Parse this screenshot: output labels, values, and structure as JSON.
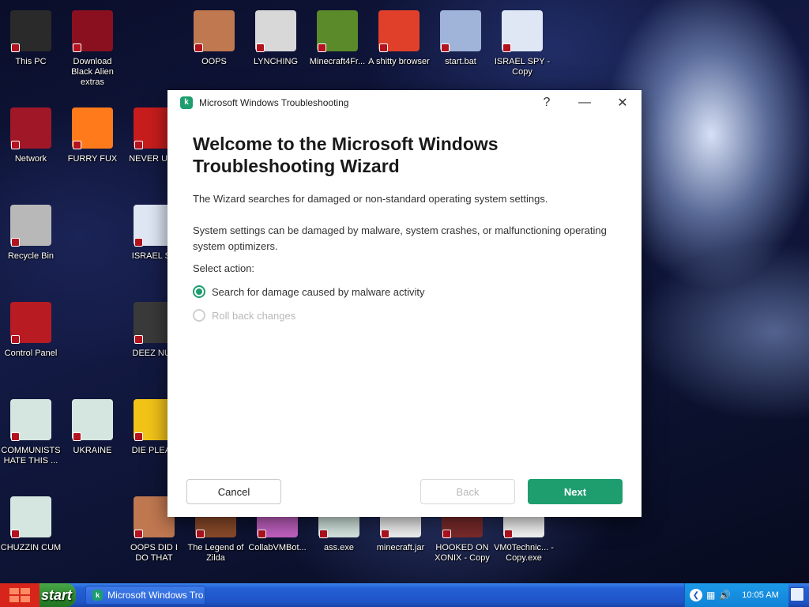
{
  "desktop": {
    "icons": [
      {
        "label": "This PC",
        "icon": "computer-icon",
        "color": "#2a2a2a"
      },
      {
        "label": "Download Black Alien extras",
        "icon": "alien-icon",
        "color": "#8a1020"
      },
      {
        "label": "OOPS",
        "icon": "portrait-icon",
        "color": "#c07850"
      },
      {
        "label": "LYNCHING",
        "icon": "rope-icon",
        "color": "#d8d8d8"
      },
      {
        "label": "Minecraft4Fr...",
        "icon": "grass-block-icon",
        "color": "#5a8a2a"
      },
      {
        "label": "A shitty browser",
        "icon": "chrome-icon",
        "color": "#e0402a"
      },
      {
        "label": "start.bat",
        "icon": "gears-icon",
        "color": "#9fb4d8"
      },
      {
        "label": "ISRAEL SPY - Copy",
        "icon": "network-pipe-icon",
        "color": "#dfe7f5"
      },
      {
        "label": "Network",
        "icon": "alien-network-icon",
        "color": "#a01828"
      },
      {
        "label": "FURRY FUX",
        "icon": "firefox-icon",
        "color": "#ff7a1a"
      },
      {
        "label": "NEVER USE",
        "icon": "devcpp-icon",
        "color": "#c81d1d"
      },
      {
        "label": "Recycle Bin",
        "icon": "recycle-bin-icon",
        "color": "#b8b8b8"
      },
      {
        "label": "ISRAEL SP",
        "icon": "network-pipe-icon",
        "color": "#dfe7f5"
      },
      {
        "label": "Control Panel",
        "icon": "control-panel-icon",
        "color": "#b81b22"
      },
      {
        "label": "DEEZ NUT",
        "icon": "copy-windows-icon",
        "color": "#3a3a3a"
      },
      {
        "label": "COMMUNISTS HATE THIS ...",
        "icon": "window-thumbnail-icon",
        "color": "#d5e6e0"
      },
      {
        "label": "UKRAINE",
        "icon": "window-thumbnail-icon",
        "color": "#d5e6e0"
      },
      {
        "label": "DIE PLEAS",
        "icon": "die-logo-icon",
        "color": "#f2c418"
      },
      {
        "label": "CHUZZIN CUM",
        "icon": "window-thumbnail-icon",
        "color": "#d5e6e0"
      },
      {
        "label": "OOPS DID I DO THAT",
        "icon": "portrait-icon",
        "color": "#c07850"
      },
      {
        "label": "The Legend of Zilda",
        "icon": "pixel-game-icon",
        "color": "#8a4a2a"
      },
      {
        "label": "CollabVMBot...",
        "icon": "monitor-icon",
        "color": "#c060c0"
      },
      {
        "label": "ass.exe",
        "icon": "window-thumbnail-icon",
        "color": "#d5e6e0"
      },
      {
        "label": "minecraft.jar",
        "icon": "java-icon",
        "color": "#f0f0f0"
      },
      {
        "label": "HOOKED ON XONIX - Copy",
        "icon": "pixel-game-icon",
        "color": "#7a2a2a"
      },
      {
        "label": "VM0Technic... - Copy.exe",
        "icon": "cloud-exe-icon",
        "color": "#f4f4f4"
      }
    ]
  },
  "dialog": {
    "title": "Microsoft Windows Troubleshooting",
    "app_icon_letter": "k",
    "help_glyph": "?",
    "minimize_glyph": "—",
    "close_glyph": "✕",
    "heading": "Welcome to the Microsoft Windows Troubleshooting Wizard",
    "paragraph1": "The Wizard searches for damaged or non-standard operating system settings.",
    "paragraph2": "System settings can be damaged by malware, system crashes, or malfunctioning operating system optimizers.",
    "select_label": "Select action:",
    "options": [
      {
        "label": "Search for damage caused by malware activity",
        "checked": true,
        "disabled": false
      },
      {
        "label": "Roll back changes",
        "checked": false,
        "disabled": true
      }
    ],
    "buttons": {
      "cancel": "Cancel",
      "back": "Back",
      "next": "Next"
    },
    "accent_color": "#1e9e6e"
  },
  "taskbar": {
    "start_label": "start",
    "task_label": "Microsoft Windows Tro...",
    "clock": "10:05 AM"
  }
}
